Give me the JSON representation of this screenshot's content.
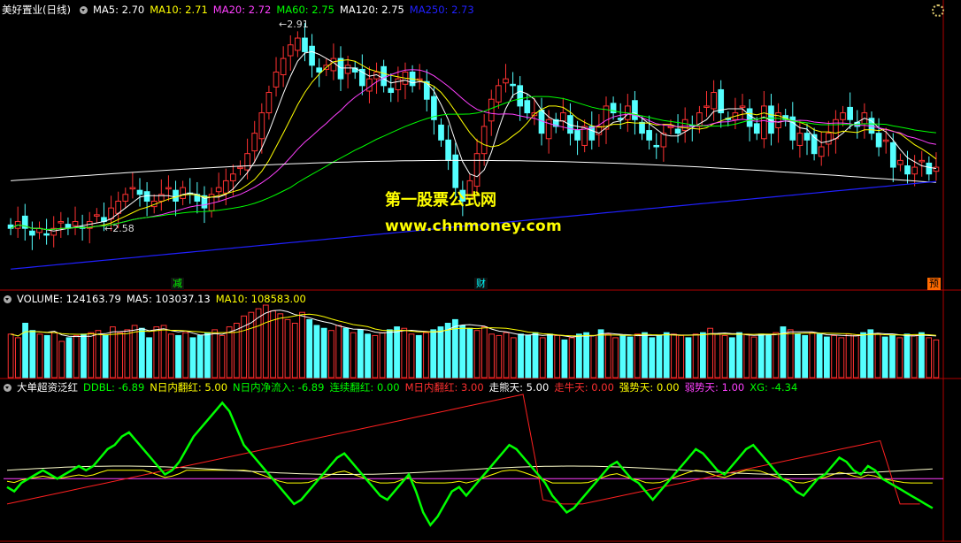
{
  "price_header": {
    "title": "美好置业(日线)",
    "items": [
      {
        "label": "MA5: 2.70",
        "color": "#ffffff"
      },
      {
        "label": "MA10: 2.71",
        "color": "#ffff00"
      },
      {
        "label": "MA20: 2.72",
        "color": "#ff40ff"
      },
      {
        "label": "MA60: 2.75",
        "color": "#00ff00"
      },
      {
        "label": "MA120: 2.75",
        "color": "#ffffff"
      },
      {
        "label": "MA250: 2.73",
        "color": "#2020ff"
      }
    ]
  },
  "volume_header": {
    "items": [
      {
        "label": "VOLUME: 124163.79",
        "color": "#ffffff"
      },
      {
        "label": "MA5: 103037.13",
        "color": "#ffffff"
      },
      {
        "label": "MA10: 108583.00",
        "color": "#ffff00"
      }
    ]
  },
  "indicator_header": {
    "title": "大单超资泛红",
    "items": [
      {
        "label": "DDBL: -6.89",
        "color": "#00ff00"
      },
      {
        "label": "N日内翻红: 5.00",
        "color": "#ffff00"
      },
      {
        "label": "N日内净流入: -6.89",
        "color": "#00ff00"
      },
      {
        "label": "连续翻红: 0.00",
        "color": "#00ff00"
      },
      {
        "label": "M日内翻红: 3.00",
        "color": "#ff3030"
      },
      {
        "label": "走熊天: 5.00",
        "color": "#ffffff"
      },
      {
        "label": "走牛天: 0.00",
        "color": "#ff3030"
      },
      {
        "label": "强势天: 0.00",
        "color": "#ffff00"
      },
      {
        "label": "弱势天: 1.00",
        "color": "#ff40ff"
      },
      {
        "label": "XG: -4.34",
        "color": "#00ff00"
      }
    ]
  },
  "annotations": {
    "high": "2.91",
    "low": "2.58"
  },
  "events": [
    {
      "label": "减",
      "color": "#00ff00",
      "bg": "#101010"
    },
    {
      "label": "财",
      "color": "#00ffff",
      "bg": "#101010"
    },
    {
      "label": "预",
      "color": "#000000",
      "bg": "#ff6a00"
    }
  ],
  "watermark": {
    "line1": "第一股票公式网",
    "line2": "www.chnmoney.com"
  },
  "colors": {
    "up": "#ff3232",
    "down": "#54ffff",
    "divider": "#b00000",
    "ma5": "#ffffff",
    "ma10": "#ffff00",
    "ma20": "#ff40ff",
    "ma60": "#00ff00",
    "ma120": "#ffffff",
    "ma250": "#2020ff",
    "ddbl": "#00ff00"
  },
  "chart_data": [
    {
      "type": "candlestick",
      "title": "美好置业(日线)",
      "price_range": [
        2.55,
        2.93
      ],
      "marked_high": 2.91,
      "marked_low": 2.58,
      "close": [
        2.62,
        2.63,
        2.62,
        2.61,
        2.62,
        2.61,
        2.62,
        2.63,
        2.62,
        2.63,
        2.62,
        2.63,
        2.64,
        2.63,
        2.65,
        2.66,
        2.67,
        2.68,
        2.67,
        2.66,
        2.66,
        2.67,
        2.68,
        2.66,
        2.68,
        2.67,
        2.66,
        2.65,
        2.67,
        2.68,
        2.69,
        2.7,
        2.71,
        2.73,
        2.76,
        2.79,
        2.82,
        2.85,
        2.87,
        2.89,
        2.9,
        2.88,
        2.86,
        2.85,
        2.86,
        2.87,
        2.84,
        2.86,
        2.85,
        2.83,
        2.84,
        2.85,
        2.83,
        2.82,
        2.84,
        2.85,
        2.83,
        2.84,
        2.81,
        2.78,
        2.75,
        2.72,
        2.68,
        2.66,
        2.69,
        2.73,
        2.77,
        2.81,
        2.83,
        2.84,
        2.83,
        2.8,
        2.79,
        2.79,
        2.76,
        2.78,
        2.77,
        2.79,
        2.76,
        2.75,
        2.77,
        2.75,
        2.77,
        2.8,
        2.79,
        2.78,
        2.8,
        2.78,
        2.76,
        2.75,
        2.74,
        2.76,
        2.77,
        2.76,
        2.78,
        2.77,
        2.79,
        2.8,
        2.82,
        2.79,
        2.78,
        2.79,
        2.8,
        2.77,
        2.76,
        2.8,
        2.76,
        2.79,
        2.78,
        2.75,
        2.76,
        2.75,
        2.73,
        2.74,
        2.76,
        2.78,
        2.79,
        2.78,
        2.77,
        2.79,
        2.76,
        2.74,
        2.75,
        2.71,
        2.72,
        2.7,
        2.71,
        2.72,
        2.7,
        2.71
      ],
      "ma_latest": {
        "MA5": 2.7,
        "MA10": 2.71,
        "MA20": 2.72,
        "MA60": 2.75,
        "MA120": 2.75,
        "MA250": 2.73
      }
    },
    {
      "type": "bar",
      "title": "VOLUME",
      "latest": 124163.79,
      "ma5": 103037.13,
      "ma10": 108583.0,
      "values": [
        60,
        55,
        75,
        65,
        60,
        58,
        62,
        50,
        55,
        58,
        60,
        62,
        65,
        58,
        70,
        62,
        66,
        72,
        68,
        55,
        70,
        72,
        60,
        58,
        62,
        55,
        58,
        62,
        66,
        58,
        70,
        75,
        85,
        90,
        95,
        100,
        92,
        88,
        80,
        75,
        90,
        80,
        72,
        68,
        65,
        72,
        68,
        62,
        66,
        60,
        58,
        62,
        66,
        70,
        68,
        60,
        58,
        62,
        66,
        70,
        75,
        80,
        72,
        68,
        65,
        70,
        60,
        58,
        62,
        55,
        60,
        58,
        62,
        55,
        60,
        58,
        52,
        55,
        60,
        62,
        58,
        66,
        60,
        55,
        58,
        56,
        60,
        62,
        55,
        58,
        62,
        60,
        58,
        55,
        60,
        62,
        68,
        60,
        58,
        55,
        62,
        60,
        56,
        60,
        58,
        62,
        70,
        66,
        60,
        58,
        62,
        60,
        56,
        58,
        55,
        60,
        58,
        62,
        66,
        60,
        56,
        58,
        55,
        60,
        58,
        62,
        55,
        52
      ],
      "y_max": 100000
    },
    {
      "type": "line",
      "title": "大单超资泛红",
      "series": [
        {
          "name": "DDBL",
          "values": [
            -2,
            -3,
            -1,
            0,
            1,
            2,
            1,
            0,
            1,
            2,
            3,
            2,
            3,
            5,
            7,
            8,
            10,
            11,
            9,
            7,
            5,
            3,
            1,
            2,
            4,
            7,
            10,
            12,
            14,
            16,
            18,
            16,
            12,
            8,
            6,
            4,
            2,
            0,
            -2,
            -4,
            -6,
            -5,
            -3,
            -1,
            1,
            3,
            5,
            6,
            4,
            2,
            0,
            -2,
            -4,
            -5,
            -3,
            -1,
            1,
            -3,
            -8,
            -11,
            -9,
            -6,
            -3,
            -2,
            -4,
            -2,
            0,
            2,
            4,
            6,
            8,
            7,
            5,
            3,
            1,
            -1,
            -4,
            -6,
            -8,
            -7,
            -5,
            -3,
            -1,
            1,
            3,
            4,
            2,
            0,
            -1,
            -3,
            -5,
            -3,
            -1,
            1,
            3,
            5,
            7,
            6,
            4,
            2,
            1,
            3,
            5,
            7,
            8,
            6,
            4,
            2,
            0,
            -1,
            -3,
            -4,
            -2,
            0,
            1,
            3,
            5,
            4,
            2,
            1,
            3,
            2,
            0,
            -1,
            -2,
            -3,
            -4,
            -5,
            -6,
            -7
          ]
        },
        {
          "name": "M日内翻红",
          "values": [
            -6,
            -5,
            -4,
            -3,
            -2,
            -1,
            0,
            1,
            2,
            3,
            4,
            5,
            6,
            7,
            8,
            9,
            10,
            11,
            12,
            13,
            14,
            15,
            16,
            17,
            18,
            19,
            20,
            -5,
            -6,
            -6,
            -5,
            -4,
            -3,
            -2,
            -1,
            0,
            1,
            2,
            3,
            4,
            5,
            6,
            7,
            8,
            9,
            -6,
            -6
          ]
        }
      ]
    }
  ]
}
